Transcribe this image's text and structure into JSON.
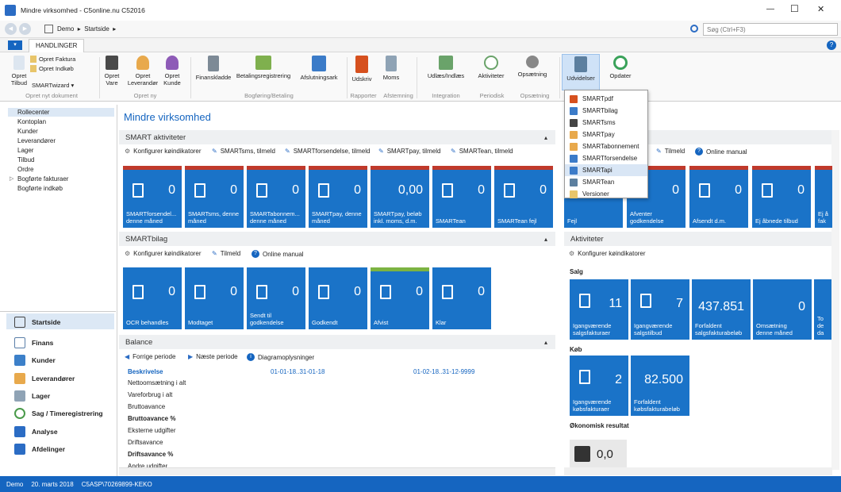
{
  "window": {
    "title": "Mindre virksomhed - C5online.nu C52016",
    "minimize": "—",
    "maximize": "☐",
    "close": "✕"
  },
  "address": {
    "back": "◀",
    "forward": "▶",
    "crumbs": "Demo  ▸  Startside  ▸",
    "search_placeholder": "Søg (Ctrl+F3)"
  },
  "ribbon_tab": "HANDLINGER",
  "ribbon": {
    "opret_faktura": "Opret Faktura",
    "opret_indkob": "Opret Indkøb",
    "opret_tilbud": "Opret\nTilbud",
    "smartwizard": "SMARTwizard ▾",
    "opret_vare": "Opret\nVare",
    "opret_leverandor": "Opret\nLeverandør",
    "opret_kunde": "Opret\nKunde",
    "finanskladde": "Finanskladde",
    "betalingsregistrering": "Betalingsregistrering",
    "afslutningsark": "Afslutningsark",
    "udskriv": "Udskriv",
    "moms": "Moms",
    "udlaes": "Udlæs/Indlæs",
    "aktiviteter": "Aktiviteter",
    "opsaetning": "Opsætning",
    "udvidelser": "Udvidelser",
    "opdater": "Opdater",
    "groups": {
      "opret_nyt": "Opret nyt dokument",
      "opret_ny": "Opret ny",
      "bogforing": "Bogføring/Betaling",
      "rapporter": "Rapporter",
      "afstemning": "Afstemning",
      "integration": "Integration",
      "periodisk": "Periodisk",
      "opsaetning": "Opsætning"
    }
  },
  "dropdown": [
    "SMARTpdf",
    "SMARTbilag",
    "SMARTsms",
    "SMARTpay",
    "SMARTabonnement",
    "SMARTforsendelse",
    "SMARTapi",
    "SMARTean",
    "Versioner"
  ],
  "nav": {
    "items": [
      "Rollecenter",
      "Kontoplan",
      "Kunder",
      "Leverandører",
      "Lager",
      "Tilbud",
      "Ordre",
      "Bogførte fakturaer",
      "Bogførte indkøb"
    ],
    "big": [
      "Startside",
      "Finans",
      "Kunder",
      "Leverandører",
      "Lager",
      "Sag / Timeregistrering",
      "Analyse",
      "Afdelinger"
    ]
  },
  "page_title": "Mindre virksomhed",
  "smart_aktiviteter": {
    "header": "SMART aktiviteter",
    "actions": [
      "Konfigurer køindikatorer",
      "SMARTsms, tilmeld",
      "SMARTforsendelse, tilmeld",
      "SMARTpay, tilmeld",
      "SMARTean, tilmeld"
    ],
    "tiles": [
      {
        "value": "0",
        "label": "SMARTforsendel...\ndenne måned"
      },
      {
        "value": "0",
        "label": "SMARTsms, denne\nmåned"
      },
      {
        "value": "0",
        "label": "SMARTabonnem...\ndenne måned"
      },
      {
        "value": "0",
        "label": "SMARTpay, denne\nmåned"
      },
      {
        "value": "0,00",
        "label": "SMARTpay, beløb\ninkl. moms, d.m."
      },
      {
        "value": "0",
        "label": "SMARTean"
      },
      {
        "value": "0",
        "label": "SMARTean fejl"
      }
    ]
  },
  "smartbilag": {
    "header": "SMARTbilag",
    "actions": [
      "Konfigurer køindikatorer",
      "Tilmeld",
      "Online manual"
    ],
    "tiles": [
      {
        "value": "0",
        "label": "OCR behandles"
      },
      {
        "value": "0",
        "label": "Modtaget"
      },
      {
        "value": "0",
        "label": "Sendt til\ngodkendelse"
      },
      {
        "value": "0",
        "label": "Godkendt"
      },
      {
        "value": "0",
        "label": "Afvist"
      },
      {
        "value": "0",
        "label": "Klar"
      }
    ]
  },
  "balance": {
    "header": "Balance",
    "actions": [
      "Forrige periode",
      "Næste periode",
      "Diagramoplysninger"
    ],
    "col_desc": "Beskrivelse",
    "col_p1": "01-01-18..31-01-18",
    "col_p2": "01-02-18..31-12-9999",
    "rows": [
      "Nettoomsætning i alt",
      "Vareforbrug i alt",
      "Bruttoavance",
      "Bruttoavance %",
      "Eksterne udgifter",
      "Driftsavance",
      "Driftsavance %",
      "Andre udgifter"
    ]
  },
  "right_top": {
    "actions": [
      "Tilmeld",
      "Online manual"
    ],
    "tiles": [
      {
        "value": "",
        "label": "Fejl"
      },
      {
        "value": "0",
        "label": "Afventer\ngodkendelse"
      },
      {
        "value": "0",
        "label": "Afsendt d.m."
      },
      {
        "value": "0",
        "label": "Ej åbnede tilbud"
      },
      {
        "value": "",
        "label": "Ej å\nfak"
      }
    ]
  },
  "aktiviteter": {
    "header": "Aktiviteter",
    "action": "Konfigurer køindikatorer",
    "salg": "Salg",
    "salg_tiles": [
      {
        "value": "11",
        "label": "Igangværende\nsalgsfakturaer"
      },
      {
        "value": "7",
        "label": "Igangværende\nsalgstilbud"
      },
      {
        "value": "437.851",
        "label": "Forfaldent\nsalgsfakturabeløb"
      },
      {
        "value": "0",
        "label": "Omsætning\ndenne måned"
      },
      {
        "value": "",
        "label": "To\nde\nda"
      }
    ],
    "kob": "Køb",
    "kob_tiles": [
      {
        "value": "2",
        "label": "Igangværende\nkøbsfakturaer"
      },
      {
        "value": "82.500",
        "label": "Forfaldent\nkøbsfakturabeløb"
      }
    ],
    "okonomisk": "Økonomisk resultat",
    "okonomisk_value": "0,0"
  },
  "status": {
    "company": "Demo",
    "date": "20. marts 2018",
    "user": "C5ASP\\70269899-KEKO"
  }
}
